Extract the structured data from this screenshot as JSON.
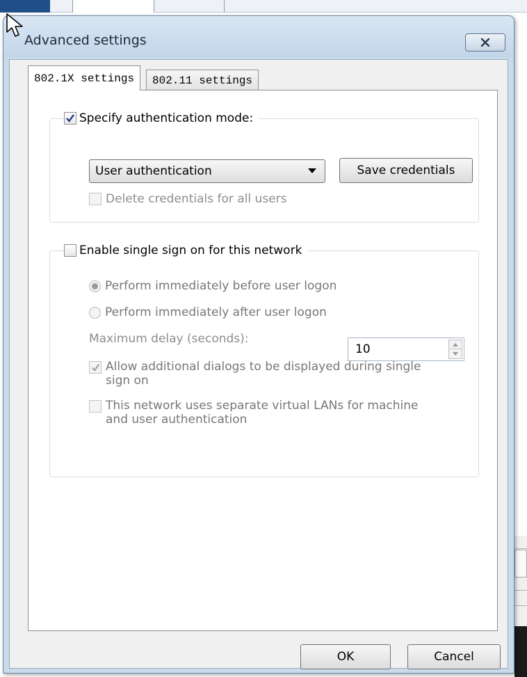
{
  "window": {
    "title": "Advanced settings"
  },
  "tabs": [
    {
      "label": "802.1X settings",
      "active": true
    },
    {
      "label": "802.11 settings",
      "active": false
    }
  ],
  "auth_group": {
    "header_label": "Specify authentication mode:",
    "header_checked": true,
    "mode_select": {
      "value": "User authentication"
    },
    "save_credentials_label": "Save credentials",
    "delete_credentials": {
      "label": "Delete credentials for all users",
      "checked": false,
      "disabled": true
    }
  },
  "sso_group": {
    "header_label": "Enable single sign on for this network",
    "header_checked": false,
    "radio_before": {
      "label": "Perform immediately before user logon",
      "selected": true
    },
    "radio_after": {
      "label": "Perform immediately after user logon",
      "selected": false
    },
    "max_delay_label": "Maximum delay (seconds):",
    "max_delay_value": "10",
    "allow_dialogs": {
      "label_line1": "Allow additional dialogs to be displayed during single",
      "label_line2": "sign on",
      "checked": true
    },
    "separate_vlans": {
      "label_line1": "This network uses separate virtual LANs for machine",
      "label_line2": "and user authentication",
      "checked": false
    }
  },
  "buttons": {
    "ok": "OK",
    "cancel": "Cancel"
  },
  "background_tab_stub": "",
  "icons": {
    "close": "close-x-icon",
    "cursor": "mouse-pointer-icon",
    "dropdown": "triangle-down-icon",
    "spin_up": "spin-up-icon",
    "spin_down": "spin-down-icon"
  },
  "colors": {
    "title_bar": "#c9daea",
    "client_bg": "#f0f0f0",
    "disabled_text": "#8d8d8d"
  }
}
